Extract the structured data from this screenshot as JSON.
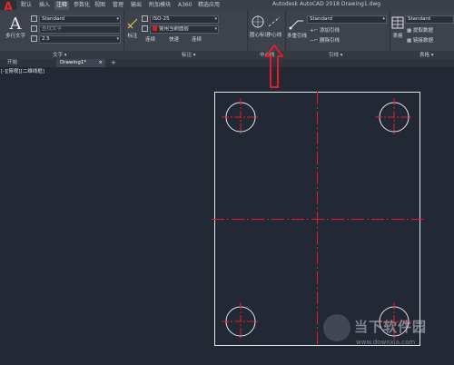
{
  "app": {
    "logo": "A",
    "title": "Autodesk AutoCAD 2018    Drawing1.dwg"
  },
  "menu_tabs": [
    "默认",
    "插入",
    "注释",
    "参数化",
    "视图",
    "管理",
    "输出",
    "附加模块",
    "A360",
    "精选应用"
  ],
  "active_menu_tab_index": 2,
  "ribbon": {
    "text_panel": {
      "multiline_text_label": "多行文字",
      "text_style": "Standard",
      "find_text_placeholder": "查找文字",
      "text_height": "2.5",
      "panel_label": "文字 ▾"
    },
    "dimension_panel": {
      "dimension_label": "标注",
      "dim_style": "ISO-25",
      "layer_value": "使用当前图层",
      "sub_buttons": [
        "连续",
        "快速",
        "连续"
      ],
      "panel_label": "标注 ▾"
    },
    "centerline_panel": {
      "center_mark_label": "圆心标记",
      "centerline_label": "中心线",
      "panel_label": "中心线"
    },
    "leader_panel": {
      "multileader_label": "多重引线",
      "leader_style": "Standard",
      "add_leader": "添加引线",
      "remove_leader": "删除引线",
      "panel_label": "引线 ▾"
    },
    "table_panel": {
      "table_label": "表格",
      "table_style": "Standard",
      "extract_data": "提取数据",
      "link_data": "链接数据",
      "panel_label": "表格 ▾"
    }
  },
  "file_tabs": [
    "开始",
    "Drawing1*"
  ],
  "active_file_tab_index": 1,
  "add_tab_label": "+",
  "viewport_label": "[-][俯视][二维线框]",
  "watermark": {
    "title": "当下软件园",
    "url": "www.downxia.com"
  },
  "colors": {
    "canvas_background": "#222834",
    "ribbon_background": "#3d424c",
    "outline_color": "#e6e6e6",
    "centerline_color": "#e01e2a",
    "annotation_arrow": "#e01e2a"
  }
}
